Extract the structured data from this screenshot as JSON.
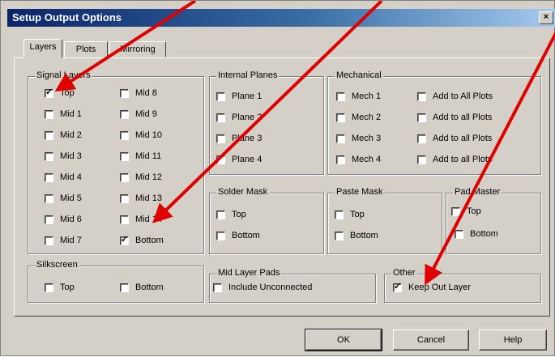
{
  "window": {
    "title": "Setup Output Options",
    "close_label": "×"
  },
  "tabs": {
    "layers": "Layers",
    "plots": "Plots",
    "mirroring": "Mirroring"
  },
  "signal_layers": {
    "label": "Signal Layers",
    "items": [
      {
        "label": "Top",
        "checked": true
      },
      {
        "label": "Mid 1",
        "checked": false
      },
      {
        "label": "Mid 2",
        "checked": false
      },
      {
        "label": "Mid 3",
        "checked": false
      },
      {
        "label": "Mid 4",
        "checked": false
      },
      {
        "label": "Mid 5",
        "checked": false
      },
      {
        "label": "Mid 6",
        "checked": false
      },
      {
        "label": "Mid 7",
        "checked": false
      },
      {
        "label": "Mid 8",
        "checked": false
      },
      {
        "label": "Mid 9",
        "checked": false
      },
      {
        "label": "Mid 10",
        "checked": false
      },
      {
        "label": "Mid 11",
        "checked": false
      },
      {
        "label": "Mid 12",
        "checked": false
      },
      {
        "label": "Mid 13",
        "checked": false
      },
      {
        "label": "Mid 14",
        "checked": false
      },
      {
        "label": "Bottom",
        "checked": true
      }
    ]
  },
  "internal_planes": {
    "label": "Internal Planes",
    "items": [
      {
        "label": "Plane 1",
        "checked": false
      },
      {
        "label": "Plane 2",
        "checked": false
      },
      {
        "label": "Plane 3",
        "checked": false
      },
      {
        "label": "Plane 4",
        "checked": false
      }
    ]
  },
  "mechanical": {
    "label": "Mechanical",
    "items": [
      {
        "label": "Mech 1",
        "checked": false
      },
      {
        "label": "Mech 2",
        "checked": false
      },
      {
        "label": "Mech 3",
        "checked": false
      },
      {
        "label": "Mech 4",
        "checked": false
      }
    ],
    "add_items": [
      {
        "label": "Add to All Plots",
        "checked": false
      },
      {
        "label": "Add to all Plots",
        "checked": false
      },
      {
        "label": "Add to all Plots",
        "checked": false
      },
      {
        "label": "Add to all Plots",
        "checked": false
      }
    ]
  },
  "solder_mask": {
    "label": "Solder Mask",
    "items": [
      {
        "label": "Top",
        "checked": false
      },
      {
        "label": "Bottom",
        "checked": false
      }
    ]
  },
  "paste_mask": {
    "label": "Paste Mask",
    "items": [
      {
        "label": "Top",
        "checked": false
      },
      {
        "label": "Bottom",
        "checked": false
      }
    ]
  },
  "pad_master": {
    "label": "Pad Master",
    "items": [
      {
        "label": "Top",
        "checked": false
      },
      {
        "label": "Bottom",
        "checked": false
      }
    ]
  },
  "silkscreen": {
    "label": "Silkscreen",
    "items": [
      {
        "label": "Top",
        "checked": false
      },
      {
        "label": "Bottom",
        "checked": false
      }
    ]
  },
  "mid_layer_pads": {
    "label": "Mid Layer Pads",
    "items": [
      {
        "label": "Include Unconnected",
        "checked": false
      }
    ]
  },
  "other": {
    "label": "Other",
    "items": [
      {
        "label": "Keep Out Layer",
        "checked": true
      }
    ]
  },
  "buttons": {
    "ok": "OK",
    "cancel": "Cancel",
    "help": "Help"
  },
  "colors": {
    "title_start": "#0a246a",
    "title_end": "#a6caf0",
    "face": "#d4d0c8",
    "arrow": "#e00000"
  }
}
